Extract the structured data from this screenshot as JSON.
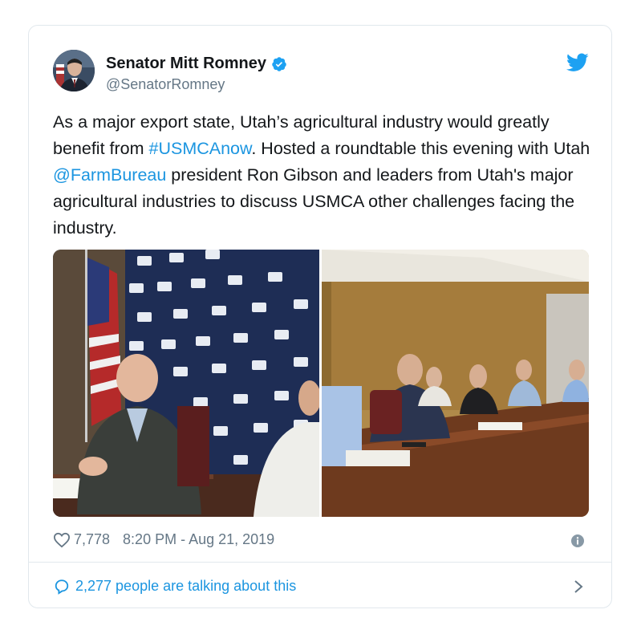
{
  "author": {
    "name": "Senator Mitt Romney",
    "handle": "@SenatorRomney"
  },
  "tweet": {
    "text_part1": "As a major export state, Utah’s agricultural industry would greatly benefit from ",
    "hashtag": "#USMCAnow",
    "text_part2": ". Hosted a roundtable this evening with Utah ",
    "mention": "@FarmBureau",
    "text_part3": " president Ron Gibson and leaders from Utah's major agricultural industries to discuss USMCA other challenges facing the industry."
  },
  "media": {
    "left_photo": "photo-of-man-at-table-with-farm-bureau-backdrop",
    "right_photo": "photo-of-roundtable-meeting"
  },
  "meta": {
    "likes": "7,778",
    "timestamp": "8:20 PM - Aug 21, 2019"
  },
  "footer": {
    "talking": "2,277 people are talking about this"
  },
  "colors": {
    "link": "#1b95e0",
    "secondary_text": "#657786",
    "border": "#e1e8ed",
    "twitter_blue": "#1da1f2"
  }
}
